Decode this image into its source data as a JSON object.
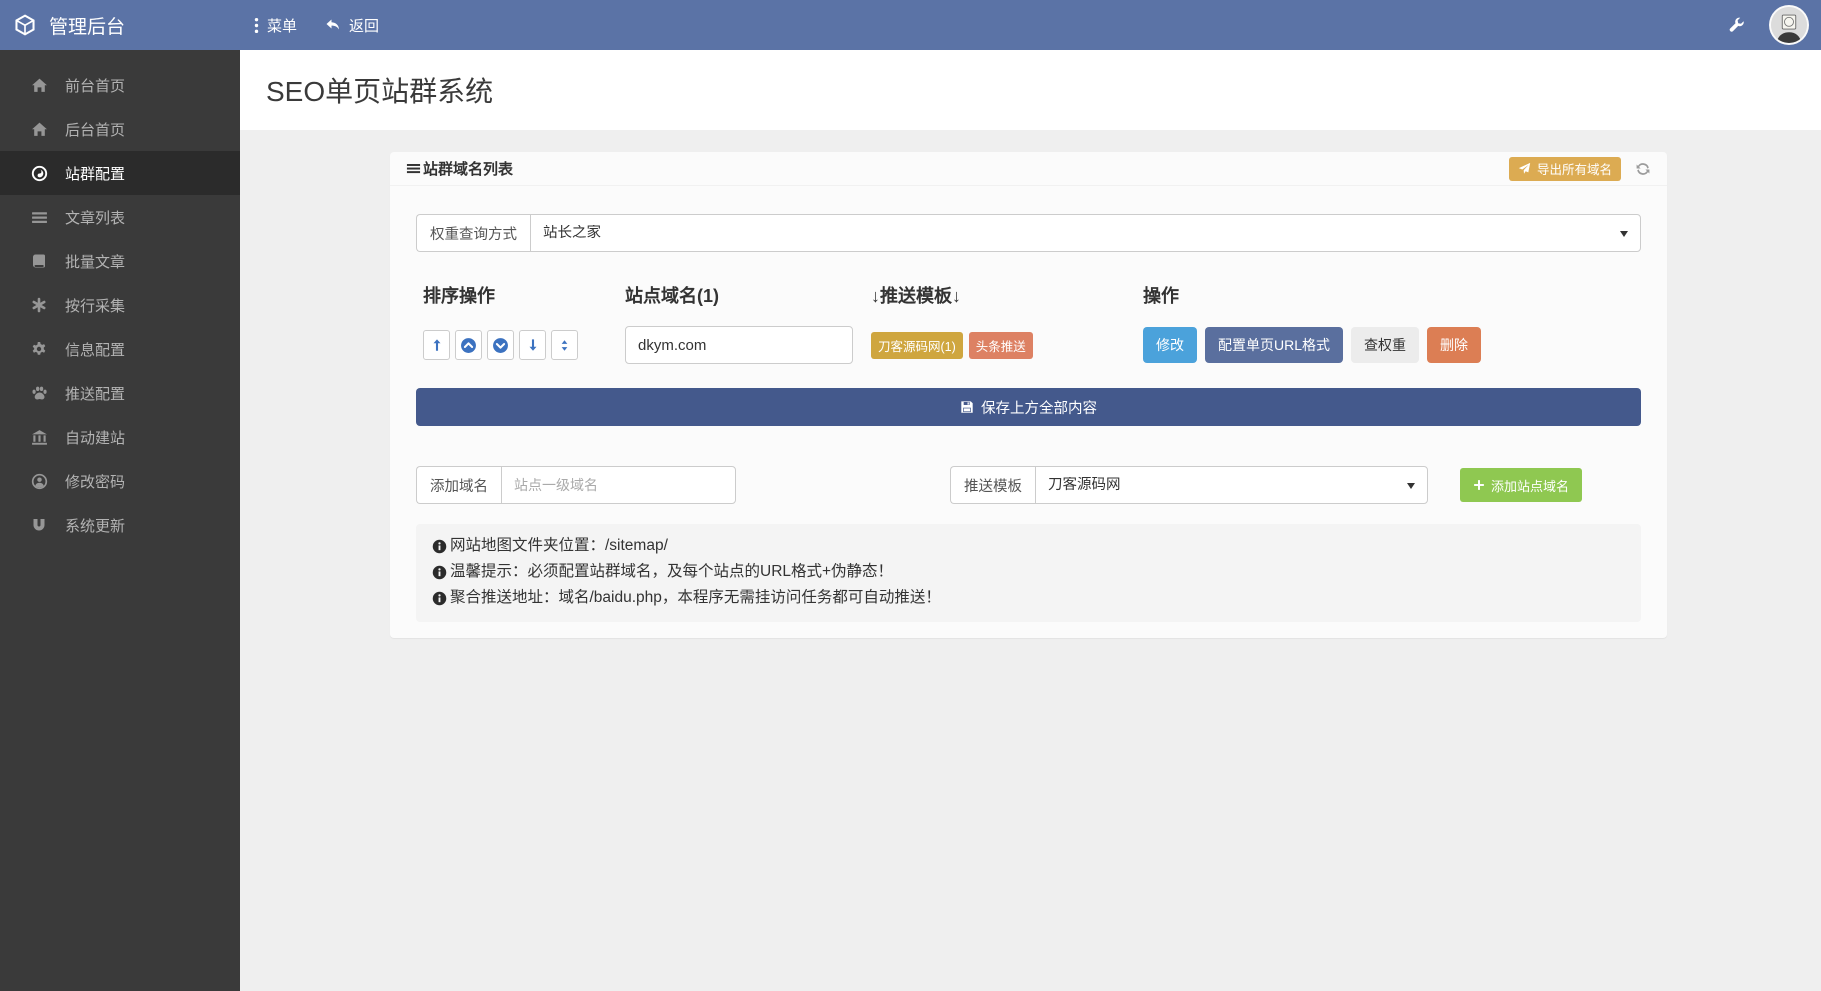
{
  "navbar": {
    "brand": "管理后台",
    "menu_label": "菜单",
    "back_label": "返回"
  },
  "sidebar": {
    "items": [
      {
        "label": "前台首页",
        "icon": "home-icon",
        "active": false
      },
      {
        "label": "后台首页",
        "icon": "home-icon",
        "active": false
      },
      {
        "label": "站群配置",
        "icon": "globe-icon",
        "active": true
      },
      {
        "label": "文章列表",
        "icon": "list-icon",
        "active": false
      },
      {
        "label": "批量文章",
        "icon": "book-icon",
        "active": false
      },
      {
        "label": "按行采集",
        "icon": "asterisk-icon",
        "active": false
      },
      {
        "label": "信息配置",
        "icon": "gear-icon",
        "active": false
      },
      {
        "label": "推送配置",
        "icon": "paw-icon",
        "active": false
      },
      {
        "label": "自动建站",
        "icon": "bank-icon",
        "active": false
      },
      {
        "label": "修改密码",
        "icon": "user-circle-icon",
        "active": false
      },
      {
        "label": "系统更新",
        "icon": "magnet-icon",
        "active": false
      }
    ]
  },
  "page": {
    "title": "SEO单页站群系统"
  },
  "panel": {
    "title": "站群域名列表",
    "export_button": "导出所有域名",
    "weight_query": {
      "label": "权重查询方式",
      "value": "站长之家"
    },
    "table": {
      "headers": [
        "排序操作",
        "站点域名(1)",
        "↓推送模板↓",
        "操作"
      ],
      "row": {
        "domain": "dkym.com",
        "badges": [
          "刀客源码网(1)",
          "头条推送"
        ],
        "actions": [
          "修改",
          "配置单页URL格式",
          "查权重",
          "删除"
        ]
      }
    },
    "save_button": "保存上方全部内容",
    "add_domain": {
      "label": "添加域名",
      "placeholder": "站点一级域名"
    },
    "push_template": {
      "label": "推送模板",
      "value": "刀客源码网"
    },
    "add_button": "添加站点域名",
    "notes": [
      "网站地图文件夹位置：/sitemap/",
      "温馨提示：必须配置站群域名，及每个站点的URL格式+伪静态！",
      "聚合推送地址：域名/baidu.php，本程序无需挂访问任务都可自动推送！"
    ]
  },
  "colors": {
    "navbar_blue": "#5b73a6",
    "sidebar_dark": "#3a3a3a",
    "gold": "#cfa63f",
    "salmon": "#dd8163",
    "info_blue": "#4ba2db",
    "slate_blue": "#5a6f9e",
    "save_blue": "#44598c",
    "delete_orange": "#dc7e54",
    "green": "#8fc851"
  }
}
